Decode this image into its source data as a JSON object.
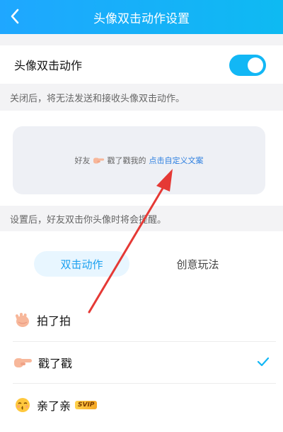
{
  "header": {
    "title": "头像双击动作设置"
  },
  "toggle": {
    "label": "头像双击动作",
    "enabled": true
  },
  "hints": {
    "off_hint": "关闭后，将无法发送和接收头像双击动作。",
    "set_hint": "设置后，好友双击你头像时将会提醒。"
  },
  "preview": {
    "friend": "好友",
    "action": "戳了戳我的",
    "link": "点击自定义文案"
  },
  "tabs": {
    "active": "双击动作",
    "other": "创意玩法"
  },
  "list": [
    {
      "name": "拍了拍",
      "icon": "clapping-hand-icon",
      "selected": false
    },
    {
      "name": "戳了戳",
      "icon": "pointing-hand-icon",
      "selected": true
    },
    {
      "name": "亲了亲",
      "icon": "kissing-face-icon",
      "badge": "SVIP",
      "selected": false
    }
  ],
  "colors": {
    "accent": "#12b7f5",
    "annotation_arrow": "#e53935"
  }
}
